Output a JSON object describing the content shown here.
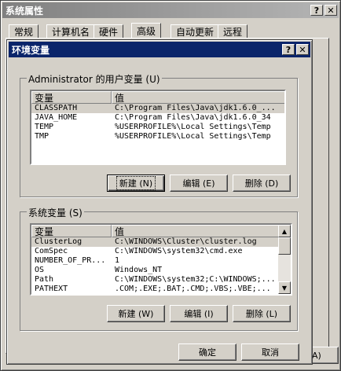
{
  "outer": {
    "title": "系统属性",
    "help": "?",
    "close": "✕",
    "tabs": [
      "常规",
      "计算机名",
      "硬件",
      "高级",
      "自动更新",
      "远程"
    ],
    "partial_button": "A)"
  },
  "dialog": {
    "title": "环境变量",
    "help": "?",
    "close": "✕",
    "user_group": "Administrator 的用户变量 (U)",
    "user_columns": [
      "变量",
      "值"
    ],
    "user_vars": [
      {
        "name": "CLASSPATH",
        "value": "C:\\Program Files\\Java\\jdk1.6.0_..."
      },
      {
        "name": "JAVA_HOME",
        "value": "C:\\Program Files\\Java\\jdk1.6.0_34"
      },
      {
        "name": "TEMP",
        "value": "%USERPROFILE%\\Local Settings\\Temp"
      },
      {
        "name": "TMP",
        "value": "%USERPROFILE%\\Local Settings\\Temp"
      }
    ],
    "user_buttons": {
      "new": "新建 (N)",
      "edit": "编辑 (E)",
      "delete": "删除 (D)"
    },
    "sys_group": "系统变量 (S)",
    "sys_columns": [
      "变量",
      "值"
    ],
    "sys_vars": [
      {
        "name": "ClusterLog",
        "value": "C:\\WINDOWS\\Cluster\\cluster.log"
      },
      {
        "name": "ComSpec",
        "value": "C:\\WINDOWS\\system32\\cmd.exe"
      },
      {
        "name": "NUMBER_OF_PR...",
        "value": "1"
      },
      {
        "name": "OS",
        "value": "Windows_NT"
      },
      {
        "name": "Path",
        "value": "C:\\WINDOWS\\system32;C:\\WINDOWS;..."
      },
      {
        "name": "PATHEXT",
        "value": ".COM;.EXE;.BAT;.CMD;.VBS;.VBE;..."
      }
    ],
    "sys_buttons": {
      "new": "新建 (W)",
      "edit": "编辑 (I)",
      "delete": "删除 (L)"
    },
    "ok": "确定",
    "cancel": "取消"
  }
}
